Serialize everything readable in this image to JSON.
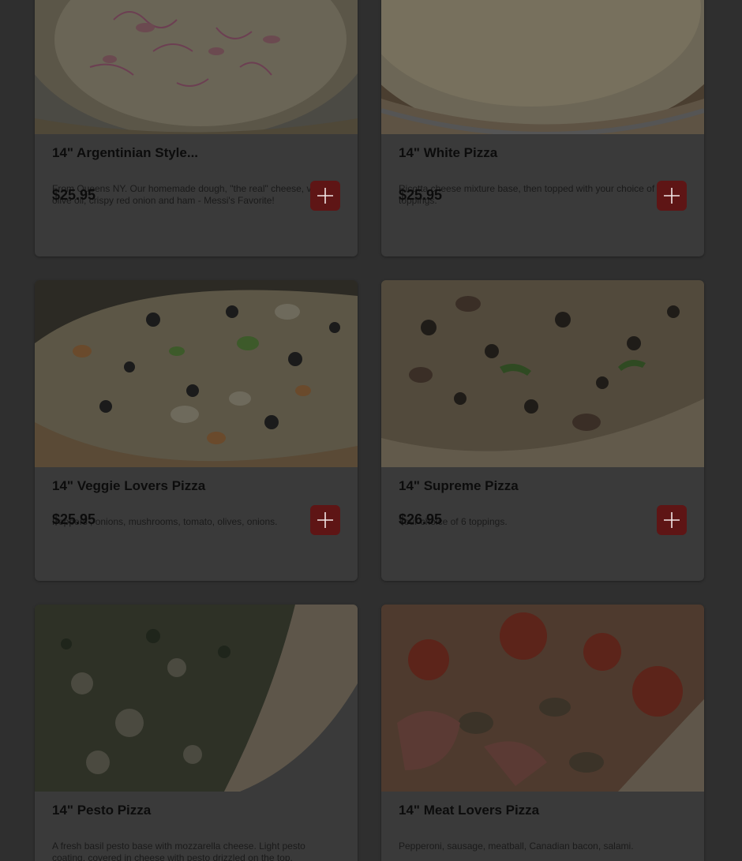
{
  "menu_items": [
    {
      "name": "14\" Argentinian Style...",
      "description": "From Queens NY. Our homemade dough, \"the real\" cheese, virgin olive oil, crispy red onion and ham - Messi's Favorite!",
      "price": "$25.95",
      "add_icon": "plus-icon"
    },
    {
      "name": "14\" White Pizza",
      "description": "Ricotta cheese mixture base, then topped with your choice of toppings.",
      "price": "$25.95",
      "add_icon": "plus-icon"
    },
    {
      "name": "14\" Veggie Lovers Pizza",
      "description": "Peppers , onions, mushrooms, tomato, olives, onions.",
      "price": "$25.95",
      "add_icon": "plus-icon"
    },
    {
      "name": "14\" Supreme Pizza",
      "description": "Your choice of 6 toppings.",
      "price": "$26.95",
      "add_icon": "plus-icon"
    },
    {
      "name": "14\" Pesto Pizza",
      "description": "A fresh basil pesto base with mozzarella cheese. Light pesto coating, covered in cheese with pesto drizzled on the top.",
      "add_icon": "plus-icon"
    },
    {
      "name": "14\" Meat Lovers Pizza",
      "description": "Pepperoni, sausage, meatball, Canadian bacon, salami.",
      "add_icon": "plus-icon"
    }
  ],
  "colors": {
    "background": "#2f2f2f",
    "card": "#3a3a3a",
    "add_button": "#5e1515",
    "add_button_plus": "#f2e6e6",
    "text": "#0c0c0c"
  }
}
